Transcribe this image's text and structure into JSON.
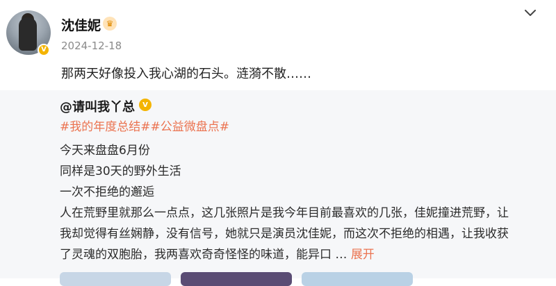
{
  "post": {
    "author": "沈佳妮",
    "date": "2024-12-18",
    "content": "那两天好像投入我心湖的石头。涟漪不散……"
  },
  "repost": {
    "handle": "@请叫我丫总",
    "hashtags": "#我的年度总结##公益微盘点#",
    "lines": [
      "今天来盘盘6月份",
      "同样是30天的野外生活",
      "一次不拒绝的邂逅",
      "人在荒野里就那么一点点，这几张照片是我今年目前最喜欢的几张，佳妮撞进荒野，让",
      "我却觉得有丝娴静，没有信号，她就只是演员沈佳妮，而这次不拒绝的相遇，让我收获",
      "了灵魂的双胞胎，我两喜欢奇奇怪怪的味道，能异口 …"
    ],
    "expand_label": "展开"
  },
  "icons": {
    "avatar": "user-avatar",
    "verified": "verified-badge-icon",
    "crown": "crown-icon",
    "chevron": "chevron-down-icon"
  },
  "colors": {
    "accent": "#eb7350",
    "verified": "#f4b400",
    "repost_bg": "#f6f7f9"
  }
}
